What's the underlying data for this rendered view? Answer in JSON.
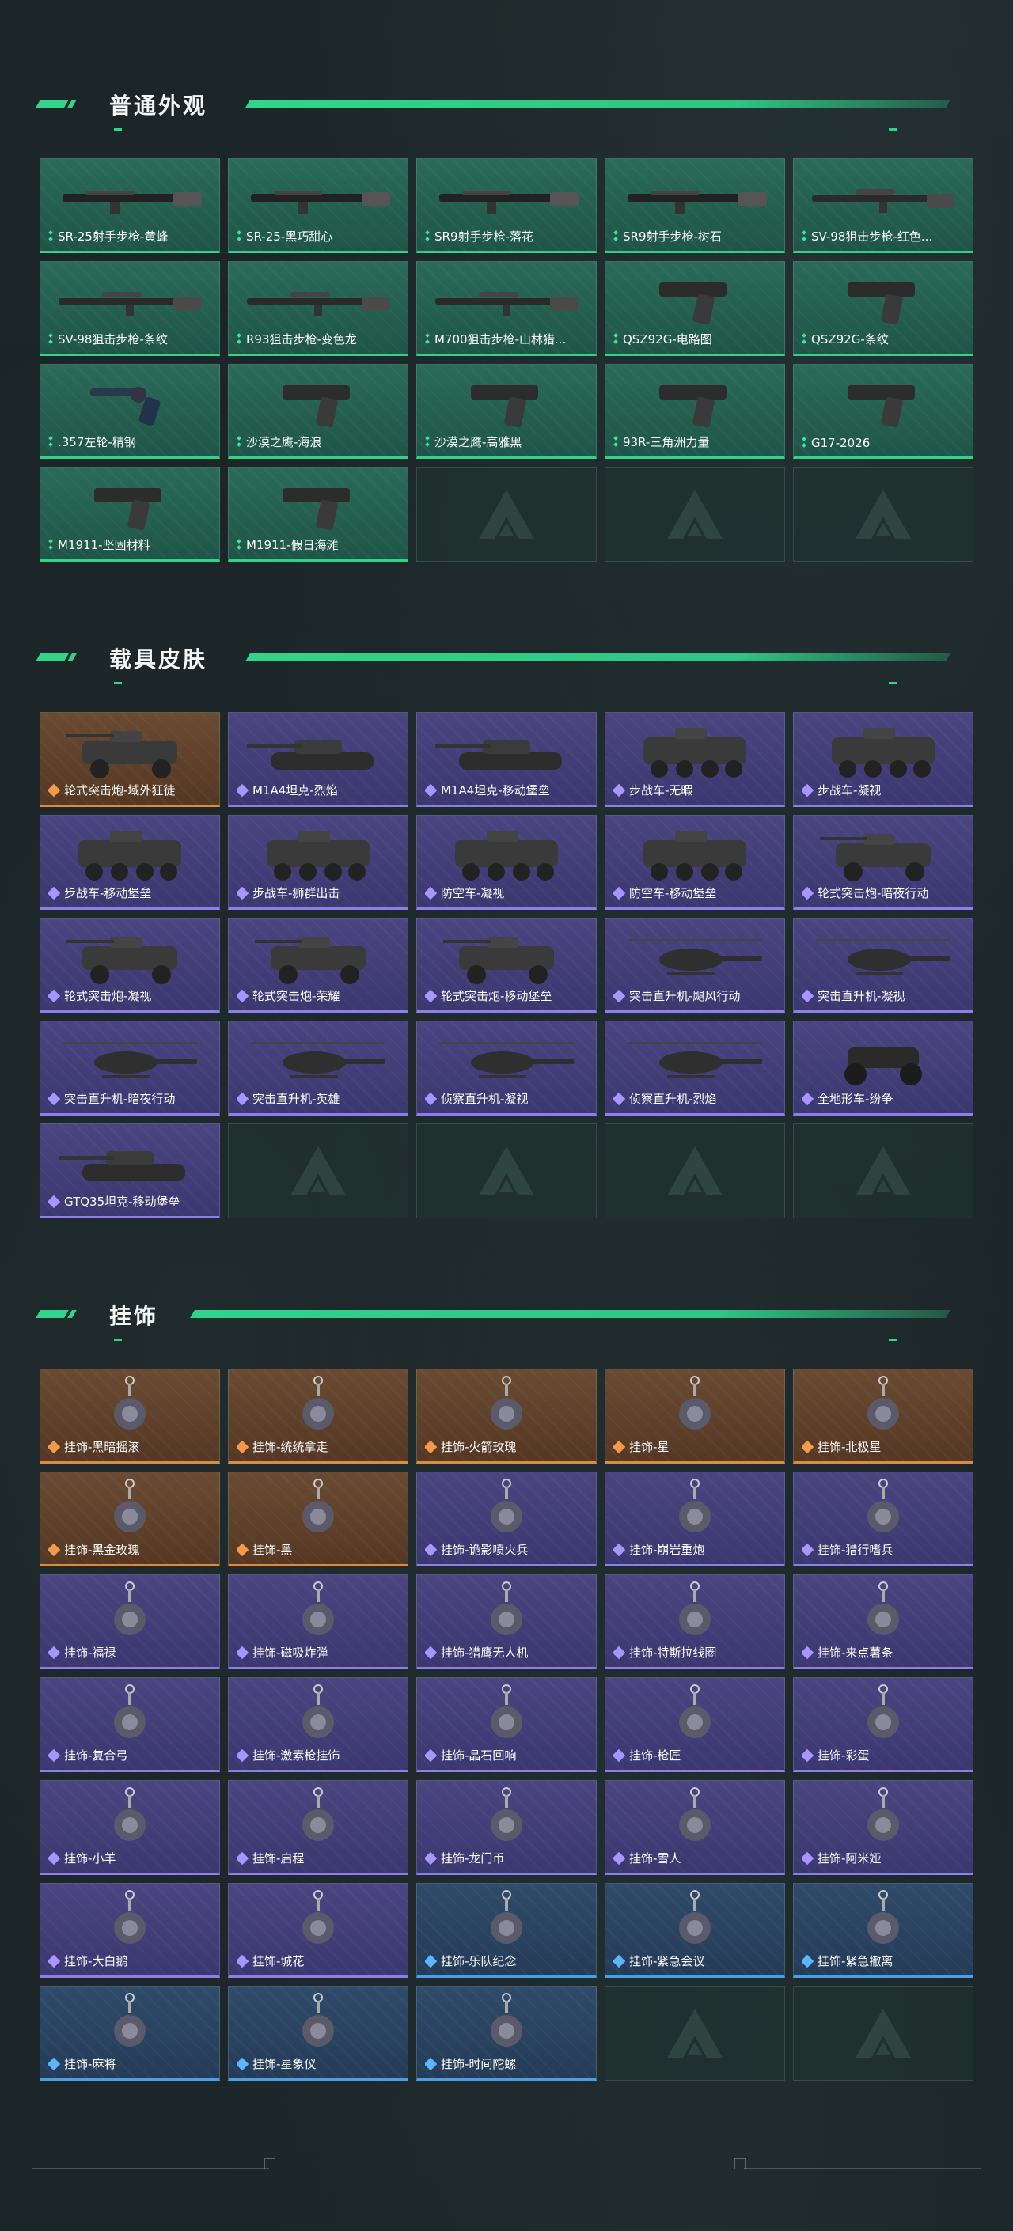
{
  "sections": {
    "skins": {
      "title": "普通外观"
    },
    "vehicles": {
      "title": "载具皮肤"
    },
    "charms": {
      "title": "挂饰"
    }
  },
  "colors": {
    "accent": "#31d48a",
    "green_card": "#2a6a58",
    "purple_card": "#4a4580",
    "orange_card": "#6a4a32",
    "blue_card": "#2f4a6a"
  },
  "skins": [
    {
      "label": "SR-25射手步枪-黄蜂",
      "rarity": "green",
      "icon": "rifle-icon"
    },
    {
      "label": "SR-25-黑巧甜心",
      "rarity": "green",
      "icon": "rifle-icon"
    },
    {
      "label": "SR9射手步枪-落花",
      "rarity": "green",
      "icon": "rifle-icon"
    },
    {
      "label": "SR9射手步枪-树石",
      "rarity": "green",
      "icon": "rifle-icon"
    },
    {
      "label": "SV-98狙击步枪-红色...",
      "rarity": "green",
      "icon": "sniper-icon"
    },
    {
      "label": "SV-98狙击步枪-条纹",
      "rarity": "green",
      "icon": "sniper-icon"
    },
    {
      "label": "R93狙击步枪-变色龙",
      "rarity": "green",
      "icon": "sniper-icon"
    },
    {
      "label": "M700狙击步枪-山林猎...",
      "rarity": "green",
      "icon": "sniper-icon"
    },
    {
      "label": "QSZ92G-电路图",
      "rarity": "green",
      "icon": "pistol-icon"
    },
    {
      "label": "QSZ92G-条纹",
      "rarity": "green",
      "icon": "pistol-icon"
    },
    {
      "label": ".357左轮-精钢",
      "rarity": "green",
      "icon": "revolver-icon"
    },
    {
      "label": "沙漠之鹰-海浪",
      "rarity": "green",
      "icon": "pistol-icon"
    },
    {
      "label": "沙漠之鹰-高雅黑",
      "rarity": "green",
      "icon": "pistol-icon"
    },
    {
      "label": "93R-三角洲力量",
      "rarity": "green",
      "icon": "pistol-icon"
    },
    {
      "label": "G17-2026",
      "rarity": "green",
      "icon": "pistol-icon"
    },
    {
      "label": "M1911-坚固材料",
      "rarity": "green",
      "icon": "pistol-icon"
    },
    {
      "label": "M1911-假日海滩",
      "rarity": "green",
      "icon": "pistol-icon"
    }
  ],
  "vehicles": [
    {
      "label": "轮式突击炮-域外狂徒",
      "rarity": "orange",
      "icon": "apc-icon"
    },
    {
      "label": "M1A4坦克-烈焰",
      "rarity": "purple",
      "icon": "tank-icon"
    },
    {
      "label": "M1A4坦克-移动堡垒",
      "rarity": "purple",
      "icon": "tank-icon"
    },
    {
      "label": "步战车-无暇",
      "rarity": "purple",
      "icon": "ifv-icon"
    },
    {
      "label": "步战车-凝视",
      "rarity": "purple",
      "icon": "ifv-icon"
    },
    {
      "label": "步战车-移动堡垒",
      "rarity": "purple",
      "icon": "ifv-icon"
    },
    {
      "label": "步战车-狮群出击",
      "rarity": "purple",
      "icon": "ifv-icon"
    },
    {
      "label": "防空车-凝视",
      "rarity": "purple",
      "icon": "ifv-icon"
    },
    {
      "label": "防空车-移动堡垒",
      "rarity": "purple",
      "icon": "ifv-icon"
    },
    {
      "label": "轮式突击炮-暗夜行动",
      "rarity": "purple",
      "icon": "apc-icon"
    },
    {
      "label": "轮式突击炮-凝视",
      "rarity": "purple",
      "icon": "apc-icon"
    },
    {
      "label": "轮式突击炮-荣耀",
      "rarity": "purple",
      "icon": "apc-icon"
    },
    {
      "label": "轮式突击炮-移动堡垒",
      "rarity": "purple",
      "icon": "apc-icon"
    },
    {
      "label": "突击直升机-飓风行动",
      "rarity": "purple",
      "icon": "helicopter-icon"
    },
    {
      "label": "突击直升机-凝视",
      "rarity": "purple",
      "icon": "helicopter-icon"
    },
    {
      "label": "突击直升机-暗夜行动",
      "rarity": "purple",
      "icon": "helicopter-icon"
    },
    {
      "label": "突击直升机-英雄",
      "rarity": "purple",
      "icon": "helicopter-icon"
    },
    {
      "label": "侦察直升机-凝视",
      "rarity": "purple",
      "icon": "helicopter-icon"
    },
    {
      "label": "侦察直升机-烈焰",
      "rarity": "purple",
      "icon": "helicopter-icon"
    },
    {
      "label": "全地形车-纷争",
      "rarity": "purple",
      "icon": "atv-icon"
    },
    {
      "label": "GTQ35坦克-移动堡垒",
      "rarity": "purple",
      "icon": "tank-icon"
    }
  ],
  "charms": [
    {
      "label": "挂饰-黑暗摇滚",
      "rarity": "orange",
      "icon": "charm-icon"
    },
    {
      "label": "挂饰-统统拿走",
      "rarity": "orange",
      "icon": "charm-icon"
    },
    {
      "label": "挂饰-火箭玫瑰",
      "rarity": "orange",
      "icon": "charm-icon"
    },
    {
      "label": "挂饰-星",
      "rarity": "orange",
      "icon": "charm-icon"
    },
    {
      "label": "挂饰-北极星",
      "rarity": "orange",
      "icon": "charm-icon"
    },
    {
      "label": "挂饰-黑金玫瑰",
      "rarity": "orange",
      "icon": "charm-icon"
    },
    {
      "label": "挂饰-黑",
      "rarity": "orange",
      "icon": "charm-icon"
    },
    {
      "label": "挂饰-诡影喷火兵",
      "rarity": "purple",
      "icon": "charm-icon"
    },
    {
      "label": "挂饰-崩岩重炮",
      "rarity": "purple",
      "icon": "charm-icon"
    },
    {
      "label": "挂饰-猎行嗜兵",
      "rarity": "purple",
      "icon": "charm-icon"
    },
    {
      "label": "挂饰-福禄",
      "rarity": "purple",
      "icon": "charm-icon"
    },
    {
      "label": "挂饰-磁吸炸弹",
      "rarity": "purple",
      "icon": "charm-icon"
    },
    {
      "label": "挂饰-猎鹰无人机",
      "rarity": "purple",
      "icon": "charm-icon"
    },
    {
      "label": "挂饰-特斯拉线圈",
      "rarity": "purple",
      "icon": "charm-icon"
    },
    {
      "label": "挂饰-来点薯条",
      "rarity": "purple",
      "icon": "charm-icon"
    },
    {
      "label": "挂饰-复合弓",
      "rarity": "purple",
      "icon": "charm-icon"
    },
    {
      "label": "挂饰-激素枪挂饰",
      "rarity": "purple",
      "icon": "charm-icon"
    },
    {
      "label": "挂饰-晶石回响",
      "rarity": "purple",
      "icon": "charm-icon"
    },
    {
      "label": "挂饰-枪匠",
      "rarity": "purple",
      "icon": "charm-icon"
    },
    {
      "label": "挂饰-彩蛋",
      "rarity": "purple",
      "icon": "charm-icon"
    },
    {
      "label": "挂饰-小羊",
      "rarity": "purple",
      "icon": "charm-icon"
    },
    {
      "label": "挂饰-启程",
      "rarity": "purple",
      "icon": "charm-icon"
    },
    {
      "label": "挂饰-龙门币",
      "rarity": "purple",
      "icon": "charm-icon"
    },
    {
      "label": "挂饰-雪人",
      "rarity": "purple",
      "icon": "charm-icon"
    },
    {
      "label": "挂饰-阿米娅",
      "rarity": "purple",
      "icon": "charm-icon"
    },
    {
      "label": "挂饰-大白鹅",
      "rarity": "purple",
      "icon": "charm-icon"
    },
    {
      "label": "挂饰-城花",
      "rarity": "purple",
      "icon": "charm-icon"
    },
    {
      "label": "挂饰-乐队纪念",
      "rarity": "blue",
      "icon": "charm-icon"
    },
    {
      "label": "挂饰-紧急会议",
      "rarity": "blue",
      "icon": "charm-icon"
    },
    {
      "label": "挂饰-紧急撤离",
      "rarity": "blue",
      "icon": "charm-icon"
    },
    {
      "label": "挂饰-麻将",
      "rarity": "blue",
      "icon": "charm-icon"
    },
    {
      "label": "挂饰-星象仪",
      "rarity": "blue",
      "icon": "charm-icon"
    },
    {
      "label": "挂饰-时间陀螺",
      "rarity": "blue",
      "icon": "charm-icon"
    }
  ]
}
